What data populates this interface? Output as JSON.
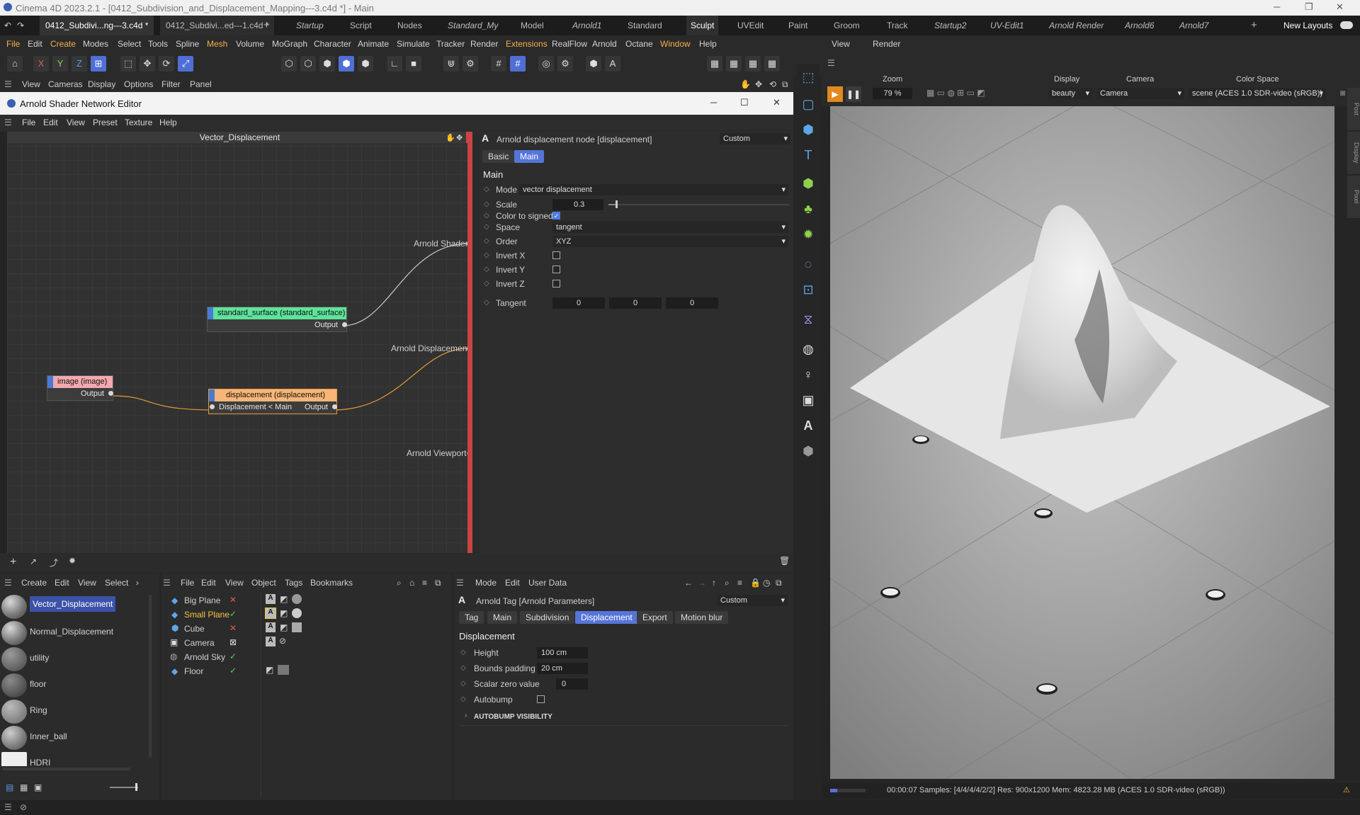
{
  "window": {
    "title": "Cinema 4D 2023.2.1 - [0412_Subdivision_and_Displacement_Mapping---3.c4d *] - Main"
  },
  "doc_tabs": [
    "0412_Subdivi...ng---3.c4d *",
    "0412_Subdivi...ed---1.c4d *"
  ],
  "layout_tabs": [
    "Startup",
    "Script",
    "Nodes",
    "Standard_My",
    "Model",
    "Arnold1",
    "Standard",
    "Sculpt",
    "UVEdit",
    "Paint",
    "Groom",
    "Track",
    "Startup2",
    "UV-Edit1",
    "Arnold Render",
    "Arnold6",
    "Arnold7"
  ],
  "new_layouts": "New Layouts",
  "menu": [
    "File",
    "Edit",
    "Create",
    "Modes",
    "Select",
    "Tools",
    "Spline",
    "Mesh",
    "Volume",
    "MoGraph",
    "Character",
    "Animate",
    "Simulate",
    "Tracker",
    "Render",
    "Extensions",
    "RealFlow",
    "Arnold",
    "Octane",
    "Window",
    "Help"
  ],
  "axes": {
    "x": "X",
    "y": "Y",
    "z": "Z"
  },
  "subbar": [
    "View",
    "Cameras",
    "Display",
    "Options",
    "Filter",
    "Panel"
  ],
  "editor": {
    "title": "Arnold Shader Network Editor",
    "menu": [
      "File",
      "Edit",
      "View",
      "Preset",
      "Texture",
      "Help"
    ],
    "graph_title": "Vector_Displacement",
    "nodes": {
      "standard": {
        "title": "standard_surface (standard_surface)",
        "port": "Output"
      },
      "image": {
        "title": "image (image)",
        "port": "Output"
      },
      "displacement": {
        "title": "displacement (displacement)",
        "in_port": "Displacement < Main",
        "out_port": "Output"
      }
    },
    "outputs": {
      "shader": "Arnold Shader",
      "displacement": "Arnold Displacement",
      "viewport": "Arnold Viewport"
    },
    "attr": {
      "header": "Arnold displacement node [displacement]",
      "preset": "Custom",
      "tabs": [
        "Basic",
        "Main"
      ],
      "section": "Main",
      "mode_label": "Mode",
      "mode_value": "vector displacement",
      "scale_label": "Scale",
      "scale_value": "0.3",
      "color_signed_label": "Color to signed",
      "space_label": "Space",
      "space_value": "tangent",
      "order_label": "Order",
      "order_value": "XYZ",
      "invert_x": "Invert X",
      "invert_y": "Invert Y",
      "invert_z": "Invert Z",
      "tangent_label": "Tangent",
      "tangent_values": [
        "0",
        "0",
        "0"
      ]
    }
  },
  "viewport": {
    "menu": [
      "View",
      "Render"
    ],
    "zoom_label": "Zoom",
    "zoom_value": "79 %",
    "display_label": "Display",
    "display_value": "beauty",
    "camera_label": "Camera",
    "camera_value": "Camera",
    "colorspace_label": "Color Space",
    "colorspace_value": "scene (ACES 1.0 SDR-video (sRGB))",
    "side_tabs": [
      "Post",
      "Display",
      "Pixel"
    ],
    "status": "00:00:07  Samples: [4/4/4/4/2/2]  Res: 900x1200  Mem: 4823.28 MB  (ACES 1.0 SDR-video (sRGB))"
  },
  "materials": {
    "menu": [
      "Create",
      "Edit",
      "View",
      "Select"
    ],
    "items": [
      "Vector_Displacement",
      "Normal_Displacement",
      "utility",
      "floor",
      "Ring",
      "Inner_ball",
      "HDRI"
    ]
  },
  "objects": {
    "menu": [
      "File",
      "Edit",
      "View",
      "Object",
      "Tags",
      "Bookmarks"
    ],
    "items": [
      "Big Plane",
      "Small Plane",
      "Cube",
      "Camera",
      "Arnold Sky",
      "Floor"
    ]
  },
  "tag": {
    "menu": [
      "Mode",
      "Edit",
      "User Data"
    ],
    "header": "Arnold Tag [Arnold Parameters]",
    "preset": "Custom",
    "tabs": [
      "Tag",
      "Main",
      "Subdivision",
      "Displacement",
      "Export",
      "Motion blur"
    ],
    "section": "Displacement",
    "height_label": "Height",
    "height_value": "100 cm",
    "bounds_label": "Bounds padding",
    "bounds_value": "20 cm",
    "scalar_label": "Scalar zero value",
    "scalar_value": "0",
    "autobump_label": "Autobump",
    "autobump_vis": "AUTOBUMP VISIBILITY"
  },
  "colors": {
    "accent": "#5675d9",
    "highlight": "#f2b14c",
    "selected_object": "#f5c542",
    "orange_wire": "#e59a3a"
  }
}
